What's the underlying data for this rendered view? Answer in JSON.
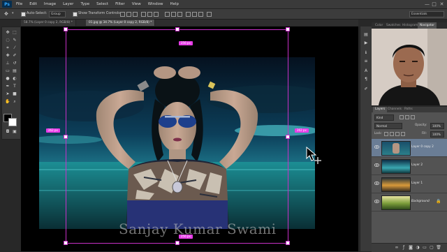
{
  "app": {
    "logo": "Ps",
    "menu": [
      "File",
      "Edit",
      "Image",
      "Layer",
      "Type",
      "Select",
      "Filter",
      "View",
      "Window",
      "Help"
    ],
    "window_controls": [
      "—",
      "□",
      "✕"
    ]
  },
  "options_bar": {
    "auto_select_label": "Auto-Select:",
    "auto_select_value": "Group",
    "show_transform_label": "Show Transform Controls",
    "workspace": "Essentials"
  },
  "tabs": [
    {
      "label": "58.7% (Layer 0 copy 2, RGB/8) *",
      "active": false
    },
    {
      "label": "01.jpg @ 34.7% (Layer 0 copy 2, RGB/8) *",
      "active": true
    }
  ],
  "canvas": {
    "measure_badges": {
      "top": "256 px",
      "left": "262 px",
      "right": "262 px",
      "bottom": "256 px"
    },
    "watermark": "Sanjay Kumar Swami"
  },
  "panels": {
    "top_tabs": [
      "Color",
      "Swatches",
      "Histogram",
      "Navigator"
    ],
    "active_top_tab": "Navigator",
    "layer_tabs": [
      "Layers",
      "Channels",
      "Paths"
    ],
    "filter_kind": "Kind",
    "blend_mode": "Normal",
    "opacity_label": "Opacity:",
    "opacity_value": "100%",
    "lock_label": "Lock:",
    "fill_label": "Fill:",
    "fill_value": "100%",
    "layers": [
      {
        "name": "Layer 0 copy 2",
        "selected": true
      },
      {
        "name": "Layer 2",
        "selected": false
      },
      {
        "name": "Layer 1",
        "selected": false
      },
      {
        "name": "Background",
        "selected": false
      }
    ]
  },
  "colors": {
    "accent_magenta": "#e83ce8",
    "selected_layer": "#6a7d95"
  }
}
